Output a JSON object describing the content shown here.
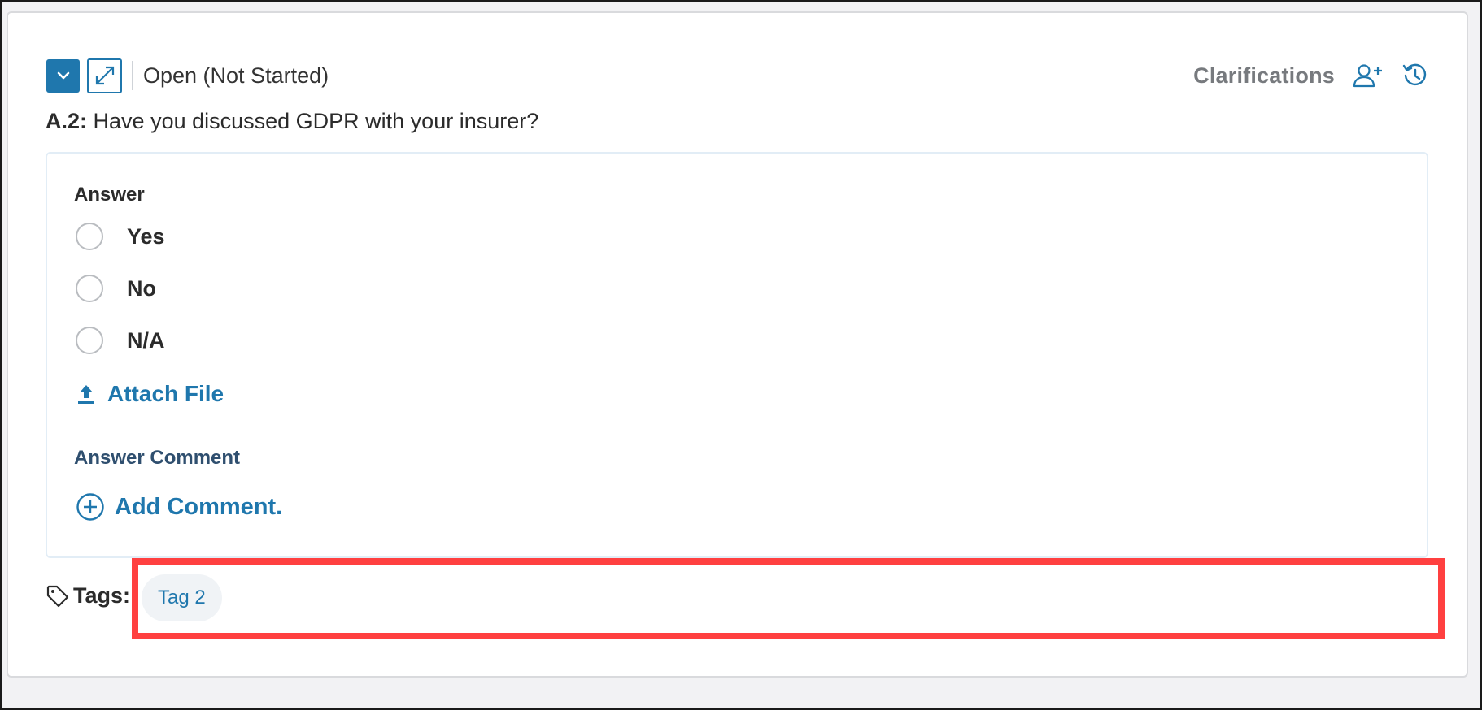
{
  "header": {
    "status": "Open (Not Started)",
    "clarifications_label": "Clarifications",
    "icons": {
      "collapse": "chevron-down-icon",
      "expand": "expand-arrows-icon",
      "add_user": "add-user-icon",
      "history": "history-icon"
    }
  },
  "question": {
    "number": "A.2:",
    "text": "Have you discussed GDPR with your insurer?"
  },
  "answer": {
    "label": "Answer",
    "options": [
      "Yes",
      "No",
      "N/A"
    ],
    "attach_label": "Attach File",
    "comment_label": "Answer Comment",
    "add_comment_label": "Add Comment."
  },
  "tags": {
    "label": "Tags:",
    "items": [
      "Tag 2"
    ]
  },
  "colors": {
    "accent": "#1f77ad",
    "highlight": "#ff4040"
  }
}
